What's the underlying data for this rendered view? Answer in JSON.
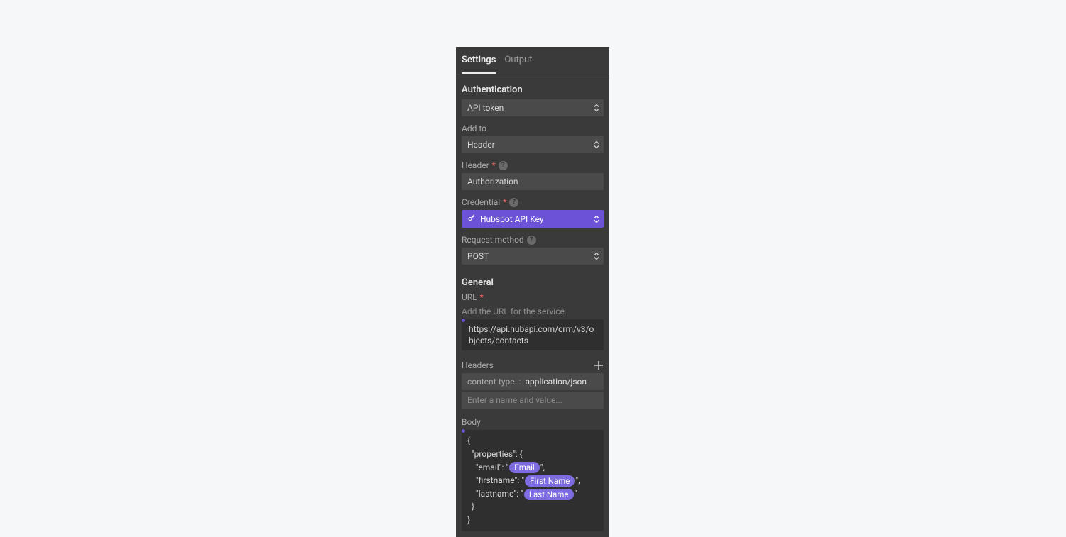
{
  "tabs": {
    "settings": "Settings",
    "output": "Output"
  },
  "auth": {
    "section": "Authentication",
    "method_value": "API token",
    "add_to_label": "Add to",
    "add_to_value": "Header",
    "header_label": "Header",
    "header_value": "Authorization",
    "credential_label": "Credential",
    "credential_value": "Hubspot API Key",
    "request_method_label": "Request method",
    "request_method_value": "POST"
  },
  "general": {
    "section": "General",
    "url_label": "URL",
    "url_hint": "Add the URL for the service.",
    "url_value": "https://api.hubapi.com/crm/v3/objects/contacts",
    "headers_label": "Headers",
    "header_key": "content-type",
    "header_sep": ":",
    "header_val": "application/json",
    "header_placeholder": "Enter a name and value...",
    "body_label": "Body",
    "body": {
      "l1": "{",
      "l2": "  \"properties\": {",
      "l3a": "    \"email\": \"",
      "l3pill": "Email",
      "l3b": "\",",
      "l4a": "    \"firstname\": \"",
      "l4pill": "First Name",
      "l4b": "\",",
      "l5a": "    \"lastname\": \"",
      "l5pill": "Last Name",
      "l5b": "\"",
      "l6": "  }",
      "l7": "}"
    }
  }
}
